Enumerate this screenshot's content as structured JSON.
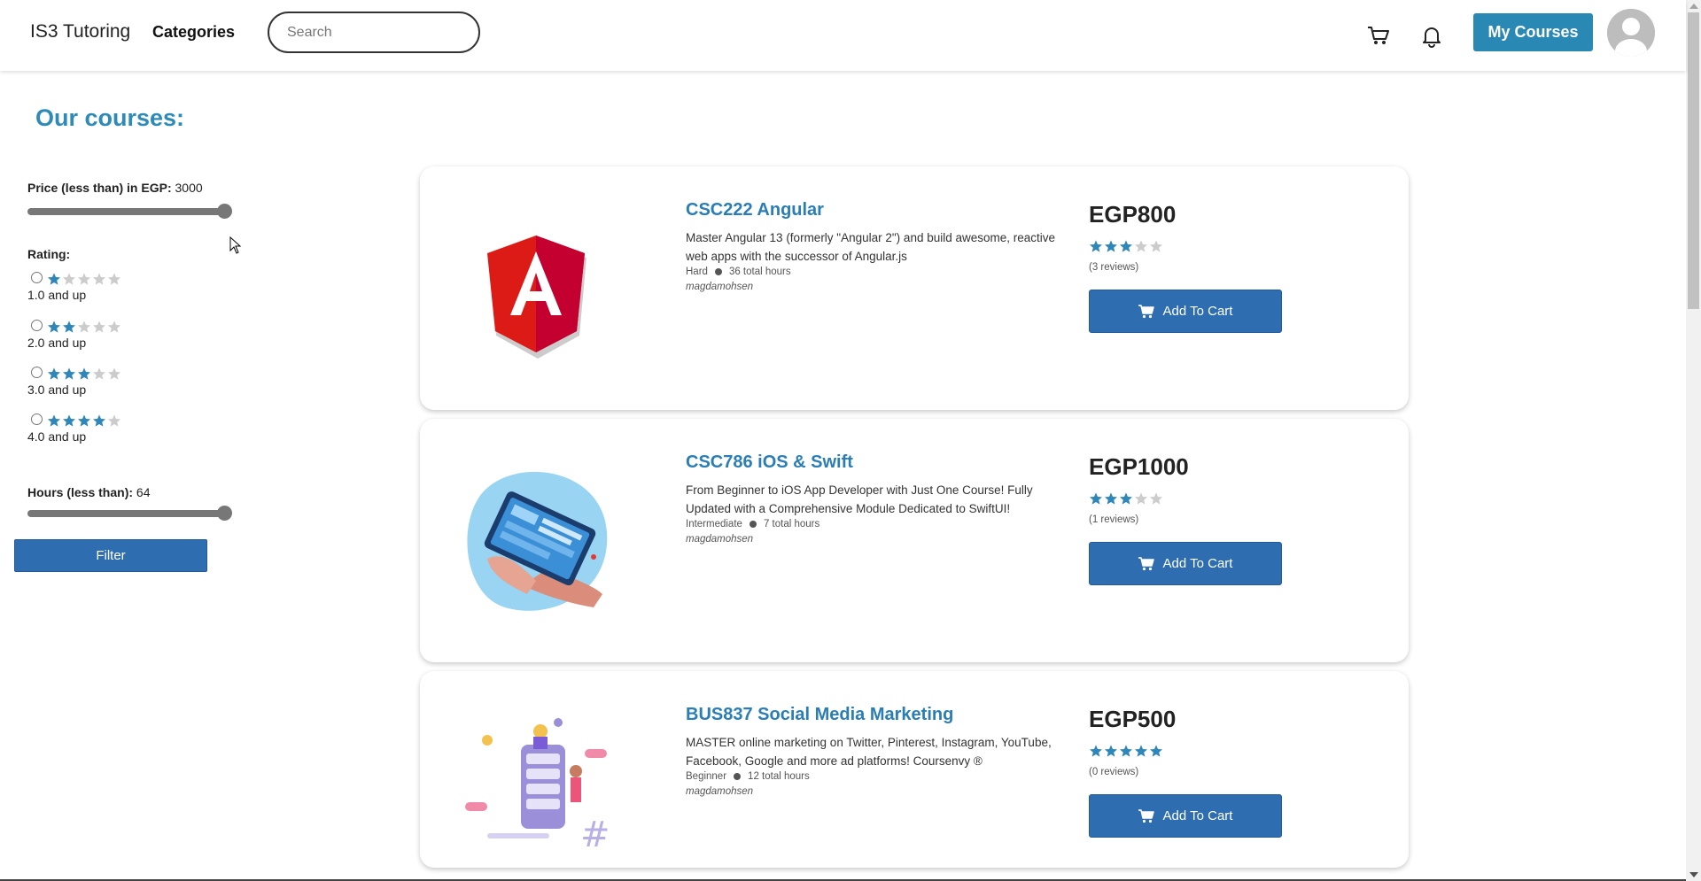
{
  "nav": {
    "brand": "IS3 Tutoring",
    "categories": "Categories",
    "search_placeholder": "Search",
    "my_courses": "My Courses"
  },
  "page": {
    "title": "Our courses:"
  },
  "filters": {
    "price_label": "Price (less than) in EGP:",
    "price_value": "3000",
    "rating_label": "Rating:",
    "rating_options": [
      {
        "stars": 1,
        "label": "1.0 and up"
      },
      {
        "stars": 2,
        "label": "2.0 and up"
      },
      {
        "stars": 3,
        "label": "3.0 and up"
      },
      {
        "stars": 4,
        "label": "4.0 and up"
      }
    ],
    "hours_label": "Hours (less than):",
    "hours_value": "64",
    "filter_button": "Filter"
  },
  "courses": [
    {
      "title": "CSC222 Angular",
      "description": "Master Angular 13 (formerly \"Angular 2\") and build awesome, reactive web apps with the successor of Angular.js",
      "difficulty": "Hard",
      "hours": "36 total hours",
      "author": "magdamohsen",
      "price": "EGP800",
      "rating": 3,
      "reviews": "(3 reviews)",
      "cart_label": "Add To Cart",
      "image": "angular-logo"
    },
    {
      "title": "CSC786 iOS & Swift",
      "description": "From Beginner to iOS App Developer with Just One Course! Fully Updated with a Comprehensive Module Dedicated to SwiftUI!",
      "difficulty": "Intermediate",
      "hours": "7 total hours",
      "author": "magdamohsen",
      "price": "EGP1000",
      "rating": 3,
      "reviews": "(1 reviews)",
      "cart_label": "Add To Cart",
      "image": "tablet-illustration"
    },
    {
      "title": "BUS837 Social Media Marketing",
      "description": "MASTER online marketing on Twitter, Pinterest, Instagram, YouTube, Facebook, Google and more ad platforms! Coursenvy ®",
      "difficulty": "Beginner",
      "hours": "12 total hours",
      "author": "magdamohsen",
      "price": "EGP500",
      "rating": 5,
      "reviews": "(0 reviews)",
      "cart_label": "Add To Cart",
      "image": "social-media-illustration"
    }
  ],
  "colors": {
    "accent": "#2e8bb8",
    "button": "#2e6db0",
    "star": "#2f86b8",
    "star_empty": "#cccccc"
  },
  "icons": [
    "cart-icon",
    "bell-icon",
    "avatar-icon",
    "star-icon",
    "shopping-cart-icon"
  ]
}
